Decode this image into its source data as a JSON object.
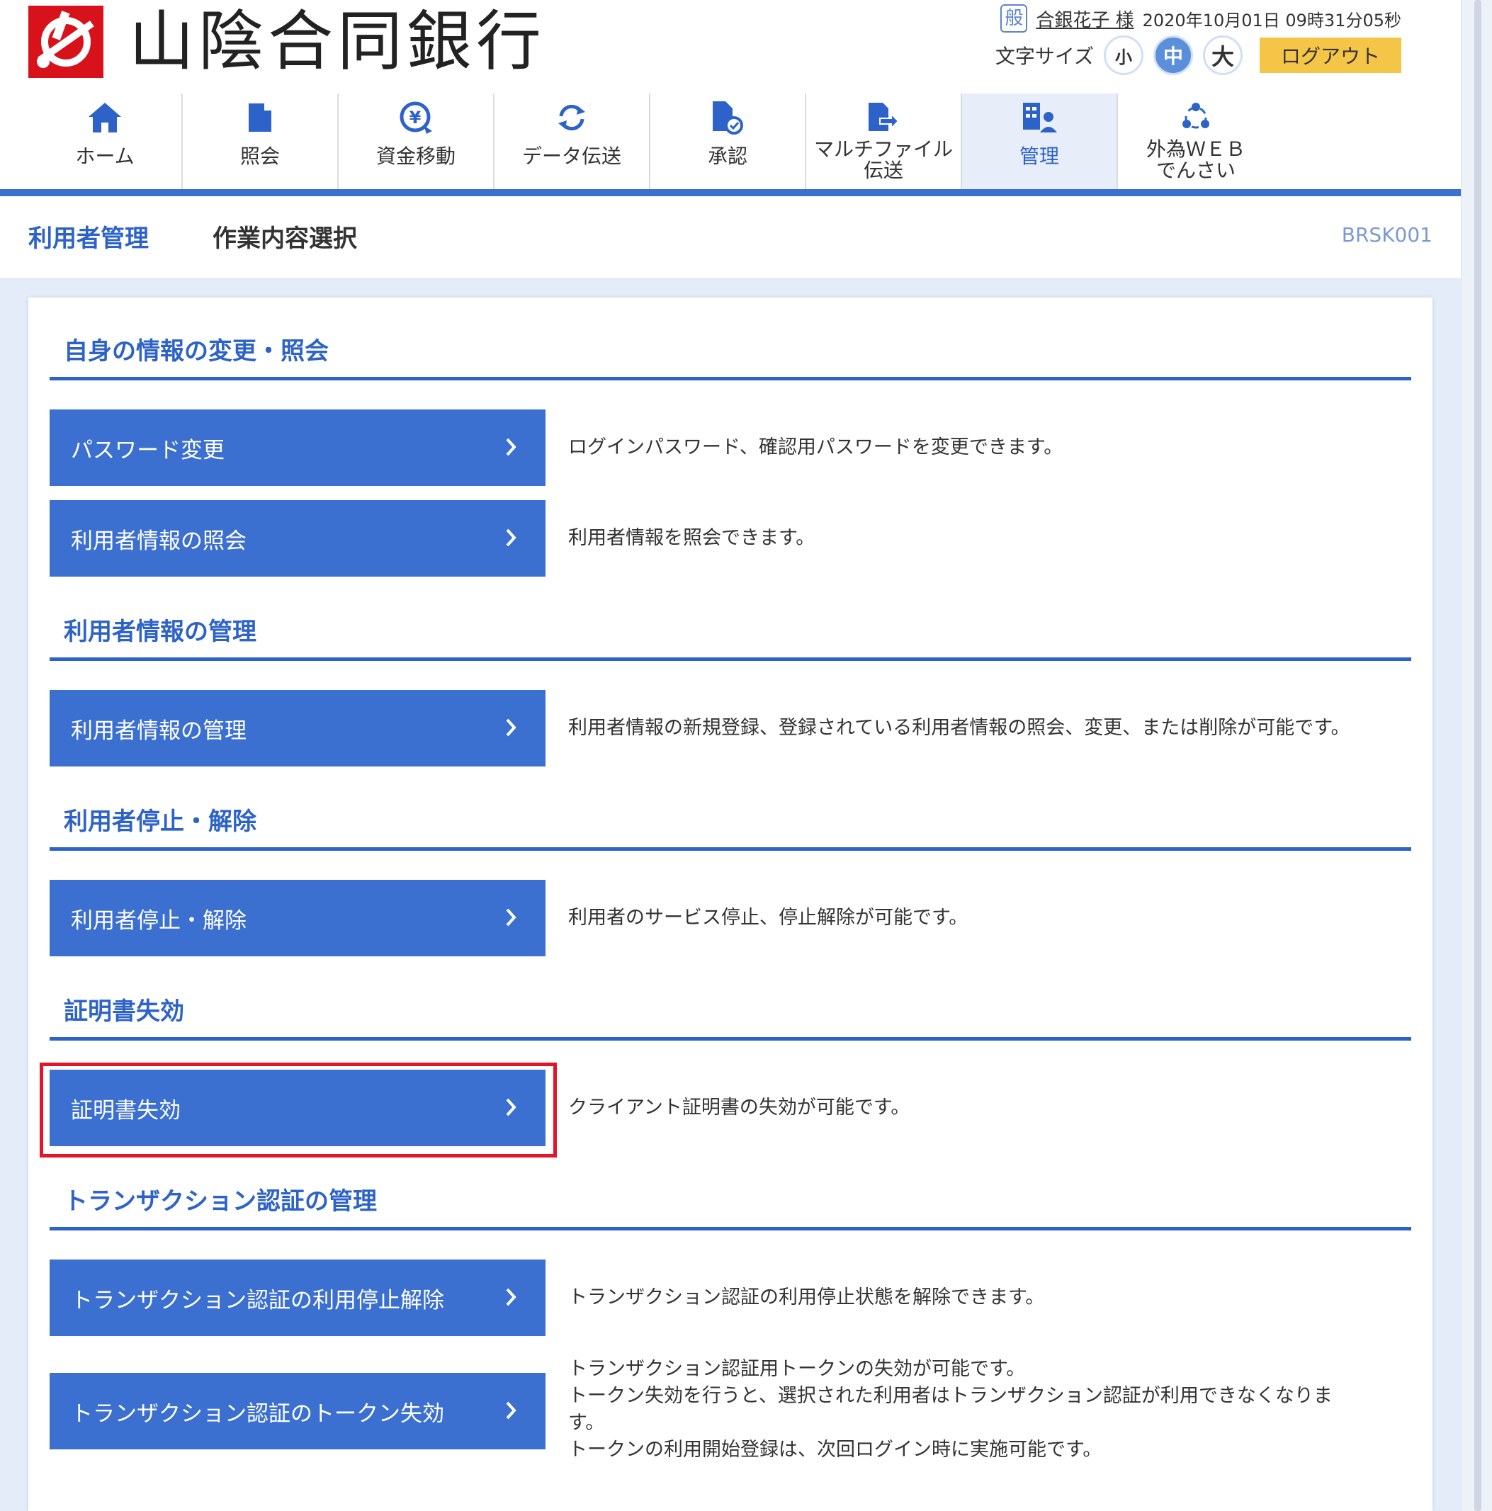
{
  "brand": {
    "name": "山陰合同銀行"
  },
  "user": {
    "badge": "般",
    "name": "合銀花子 様",
    "datetime": "2020年10月01日 09時31分05秒"
  },
  "font_size": {
    "label": "文字サイズ",
    "small": "小",
    "medium": "中",
    "large": "大",
    "selected": "medium"
  },
  "logout_label": "ログアウト",
  "nav": {
    "items": [
      {
        "label": "ホーム",
        "icon": "home-icon"
      },
      {
        "label": "照会",
        "icon": "document-icon"
      },
      {
        "label": "資金移動",
        "icon": "yen-transfer-icon"
      },
      {
        "label": "データ伝送",
        "icon": "refresh-icon"
      },
      {
        "label": "承認",
        "icon": "document-check-icon"
      },
      {
        "label_line1": "マルチファイル",
        "label_line2": "伝送",
        "icon": "file-send-icon"
      },
      {
        "label": "管理",
        "icon": "admin-icon",
        "active": true
      },
      {
        "label_line1": "外為ＷＥＢ",
        "label_line2": "でんさい",
        "icon": "network-icon"
      }
    ]
  },
  "breadcrumb": {
    "parent": "利用者管理",
    "current": "作業内容選択",
    "screen_id": "BRSK001"
  },
  "sections": [
    {
      "title": "自身の情報の変更・照会",
      "actions": [
        {
          "label": "パスワード変更",
          "desc": "ログインパスワード、確認用パスワードを変更できます。"
        },
        {
          "label": "利用者情報の照会",
          "desc": "利用者情報を照会できます。"
        }
      ]
    },
    {
      "title": "利用者情報の管理",
      "actions": [
        {
          "label": "利用者情報の管理",
          "desc": "利用者情報の新規登録、登録されている利用者情報の照会、変更、または削除が可能です。"
        }
      ]
    },
    {
      "title": "利用者停止・解除",
      "actions": [
        {
          "label": "利用者停止・解除",
          "desc": "利用者のサービス停止、停止解除が可能です。"
        }
      ]
    },
    {
      "title": "証明書失効",
      "actions": [
        {
          "label": "証明書失効",
          "desc": "クライアント証明書の失効が可能です。",
          "highlighted": true
        }
      ]
    },
    {
      "title": "トランザクション認証の管理",
      "actions": [
        {
          "label": "トランザクション認証の利用停止解除",
          "desc": "トランザクション認証の利用停止状態を解除できます。"
        },
        {
          "label": "トランザクション認証のトークン失効",
          "desc_lines": [
            "トランザクション認証用トークンの失効が可能です。",
            "トークン失効を行うと、選択された利用者はトランザクション認証が利用できなくなりま",
            "す。",
            "トークンの利用開始登録は、次回ログイン時に実施可能です。"
          ]
        }
      ]
    }
  ],
  "colors": {
    "primary": "#3b6fd0",
    "accent_text": "#2d63c9",
    "highlight": "#e3152a",
    "logout": "#f5c548",
    "brand_red": "#d7121a"
  }
}
